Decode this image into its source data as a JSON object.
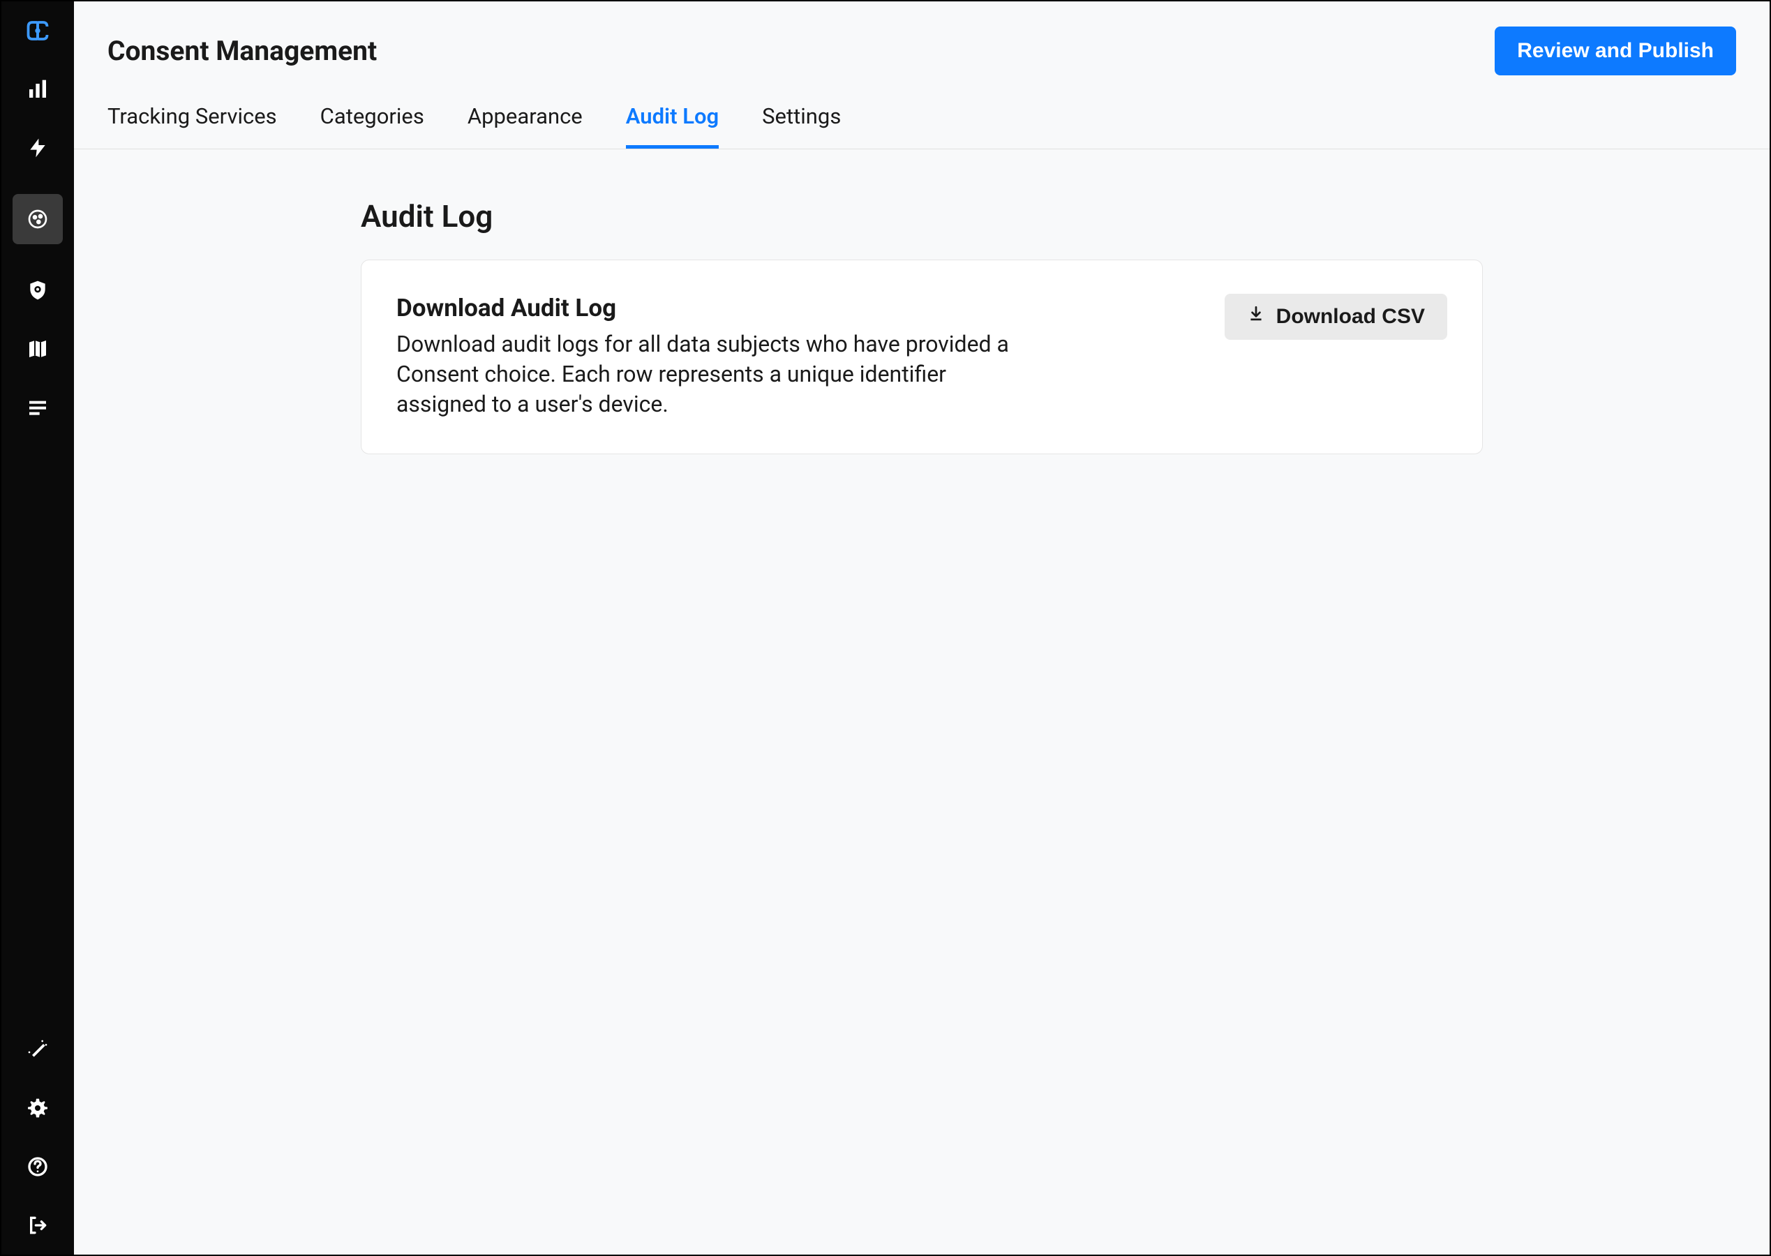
{
  "header": {
    "title": "Consent Management",
    "primary_button": "Review and Publish"
  },
  "tabs": [
    {
      "label": "Tracking Services",
      "active": false
    },
    {
      "label": "Categories",
      "active": false
    },
    {
      "label": "Appearance",
      "active": false
    },
    {
      "label": "Audit Log",
      "active": true
    },
    {
      "label": "Settings",
      "active": false
    }
  ],
  "content": {
    "heading": "Audit Log",
    "card": {
      "title": "Download Audit Log",
      "description": "Download audit logs for all data subjects who have provided a Consent choice. Each row represents a unique identifier assigned to a user's device.",
      "button": "Download CSV"
    }
  },
  "sidebar": {
    "top_icons": [
      "logo",
      "analytics",
      "lightning",
      "consent",
      "privacy",
      "map",
      "list"
    ],
    "bottom_icons": [
      "magic",
      "settings",
      "help",
      "logout"
    ]
  },
  "colors": {
    "primary": "#0d7aff",
    "sidebar_bg": "#0a0a0a",
    "main_bg": "#f8f9fa",
    "secondary_btn_bg": "#eaeaea"
  }
}
